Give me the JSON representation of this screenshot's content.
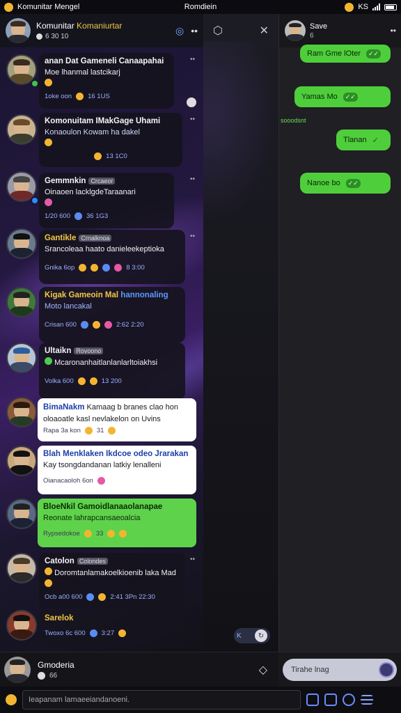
{
  "statusbar": {
    "app_name": "Komunitar Mengel",
    "center_title": "Romdiein",
    "right_text": "KS"
  },
  "left_header": {
    "title": "Komunitar",
    "title2": "Komaniurtar",
    "sub": "6 30 10"
  },
  "chats": [
    {
      "name": "anan Dat Gameneli Canaapahai",
      "msg": "Moe lhanmal lastcikarj",
      "meta": "1oke oon",
      "count": "16 1US"
    },
    {
      "name": "Komonuitam IMakGage Uhami",
      "msg": "Konaoulon Kowam ha dakel",
      "meta": "",
      "count": "13 1C0"
    },
    {
      "name": "Gemmnkin",
      "tag": "Crcaeor",
      "msg": "Oinaoen lacklgdeTaraanari",
      "meta": "1/20 600",
      "count": "36 1G3"
    },
    {
      "name": "Gantikle",
      "tag": "Crnalknoa",
      "msg": "Srancoleaa haato danieleekeptioka",
      "meta": "Gnika 6op",
      "count": "8 3:00"
    },
    {
      "name": "Kigak Gameoin Mal",
      "name2": "hannonaling",
      "msg": "Moto lancakal",
      "meta": "Crisan 600",
      "count": "2:62 2:20"
    },
    {
      "name": "Ultaikn",
      "tag": "Rovoono",
      "msg": "Mcaronanhaitlanlanlarltoiakhsi",
      "meta": "Volka 600",
      "count": "13 200"
    },
    {
      "name": "BimaNakm",
      "msg": "Kamaag b branes clao hon",
      "msg2": "oloaoatle kasl nevlakelon on Uvins",
      "meta": "Rapa 3a kon",
      "count": "31"
    },
    {
      "name": "Blah Menklaken Ikdcoe odeo Jrarakan",
      "msg": "Kay tsongdandanan latkiy lenalleni",
      "meta": "Oianacaoloh 6on",
      "count": ""
    },
    {
      "name": "BloeNkil Gamoidlanaaolanapae",
      "msg": "Reonate lahrapcansaeoalcia",
      "meta": "Rypsedokoe",
      "count": "33"
    },
    {
      "name": "Catolon",
      "tag": "Colondes",
      "msg": "Doromtanlamakoelkioenib laka Mad",
      "meta": "Ocb a00 600",
      "count": "2:41 3Pn 22:30"
    },
    {
      "name": "Sarelok",
      "msg": "",
      "meta": "Twoxo 6c 600",
      "count": "3:27"
    }
  ],
  "right_header": {
    "title": "Save",
    "sub": "6"
  },
  "right_messages": [
    "Ram Gme lOter",
    "Yamas Mo",
    "Tlanan",
    "Nanoe bo"
  ],
  "right_note": "sooodsnt",
  "mid_chip": "K",
  "bottom_left": {
    "name": "Gmoderia",
    "sub": "66"
  },
  "right_input": "Tirahe lnag",
  "footer_input": "Ieapanam lamaeeiandanoeni.",
  "colors": {
    "accent_green": "#4fce3c",
    "accent_blue": "#5a9bff",
    "gold": "#f2c744"
  }
}
